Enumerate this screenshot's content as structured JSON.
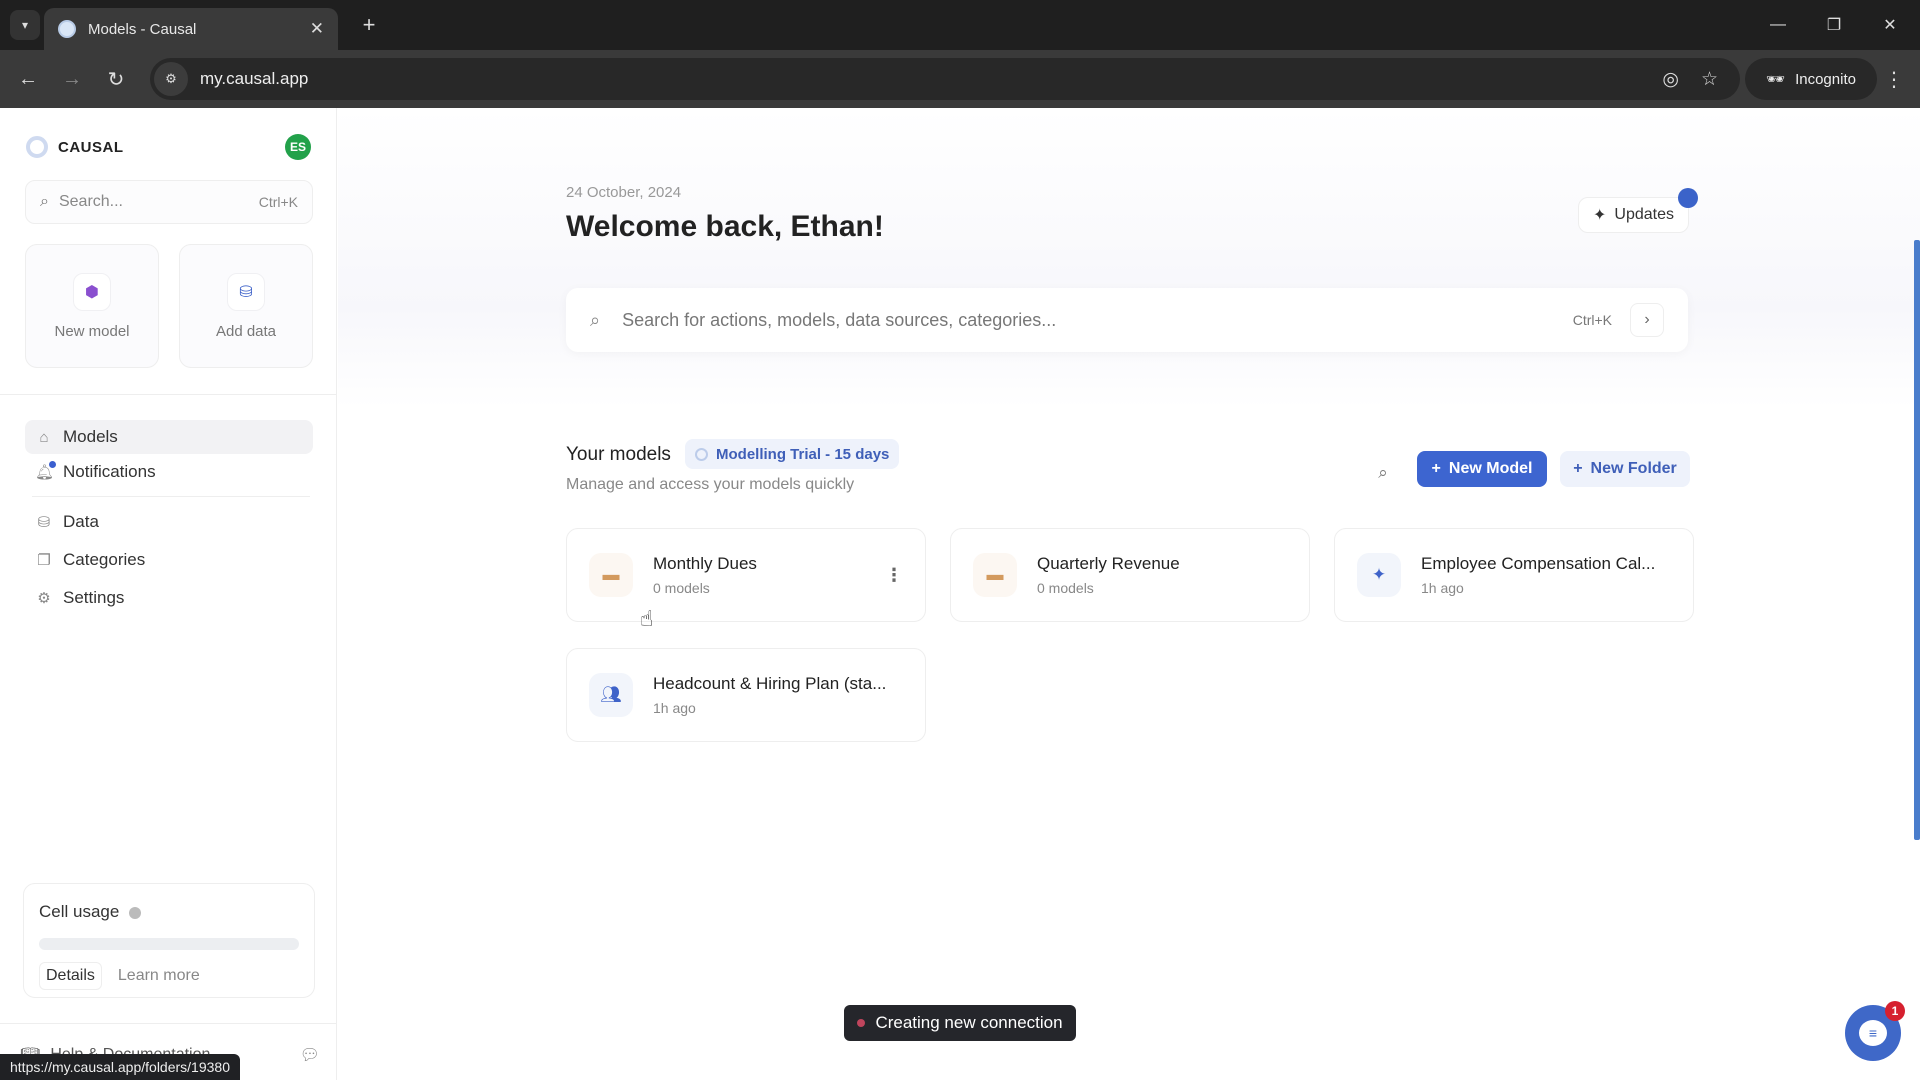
{
  "browser": {
    "tab_title": "Models - Causal",
    "url": "my.causal.app",
    "profile_label": "Incognito",
    "status_url": "https://my.causal.app/folders/19380"
  },
  "sidebar": {
    "brand": "CAUSAL",
    "avatar_initials": "ES",
    "search_placeholder": "Search...",
    "search_shortcut": "Ctrl+K",
    "quick_actions": [
      {
        "label": "New model",
        "icon": "cube-icon"
      },
      {
        "label": "Add data",
        "icon": "database-icon"
      }
    ],
    "nav_items": [
      {
        "label": "Models",
        "icon": "home-icon",
        "active": true
      },
      {
        "label": "Notifications",
        "icon": "bell-icon",
        "has_dot": true
      },
      {
        "label": "Data",
        "icon": "database-icon"
      },
      {
        "label": "Categories",
        "icon": "copy-icon"
      },
      {
        "label": "Settings",
        "icon": "gear-icon"
      }
    ],
    "cell_usage": {
      "title": "Cell usage",
      "progress": 0,
      "details_label": "Details",
      "learn_more_label": "Learn more"
    },
    "help_label": "Help & Documentation"
  },
  "main": {
    "date": "24 October, 2024",
    "welcome": "Welcome back, Ethan!",
    "updates_label": "Updates",
    "search_placeholder": "Search for actions, models, data sources, categories...",
    "search_shortcut": "Ctrl+K",
    "models_section": {
      "title": "Your models",
      "trial_badge": "Modelling Trial - 15 days",
      "subtitle": "Manage and access your models quickly",
      "new_model_label": "New Model",
      "new_folder_label": "New Folder"
    },
    "cards": [
      {
        "name": "Monthly Dues",
        "meta": "0 models",
        "type": "folder"
      },
      {
        "name": "Quarterly Revenue",
        "meta": "0 models",
        "type": "folder"
      },
      {
        "name": "Employee Compensation Cal...",
        "meta": "1h ago",
        "type": "sparkle"
      },
      {
        "name": "Headcount & Hiring Plan (sta...",
        "meta": "1h ago",
        "type": "people"
      }
    ]
  },
  "toast": {
    "text": "Creating new connection",
    "dot_color": "#c0455d"
  },
  "chat": {
    "badge_count": "1"
  },
  "colors": {
    "accent": "#3d65d0",
    "avatar": "#22a14a"
  }
}
